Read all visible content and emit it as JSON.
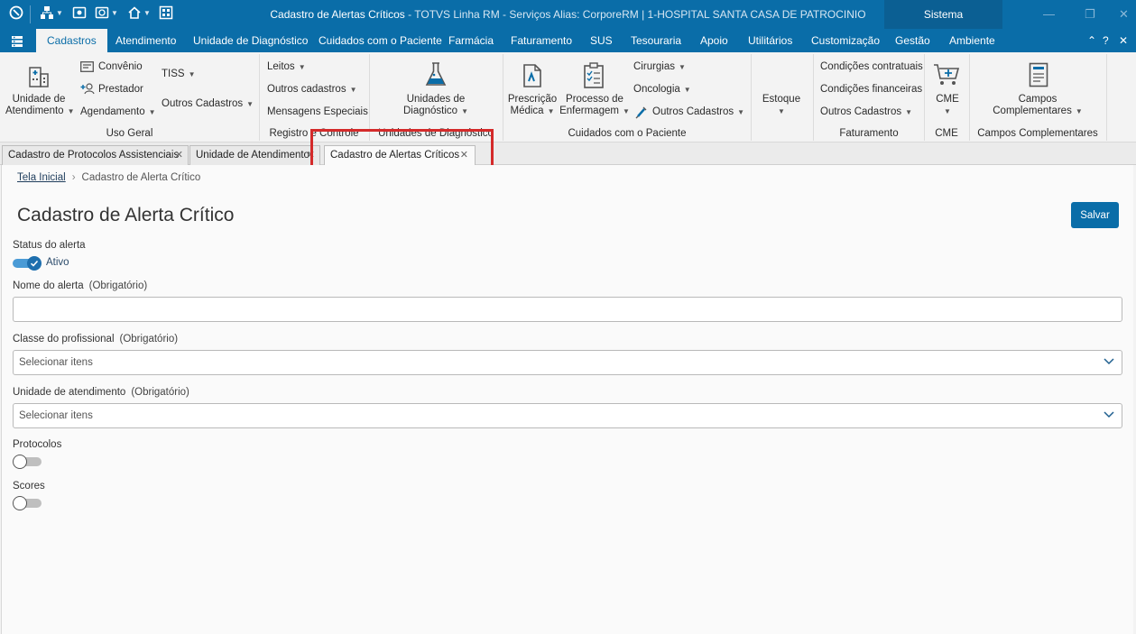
{
  "window": {
    "title": "Cadastro de Alertas Críticos",
    "subtitle": " - TOTVS Linha RM - Serviços  Alias: CorporeRM | 1-HOSPITAL SANTA CASA DE PATROCINIO",
    "sistema": "Sistema"
  },
  "menu": {
    "tabs": [
      "Cadastros",
      "Atendimento",
      "Unidade de Diagnóstico",
      "Cuidados com o Paciente",
      "Farmácia",
      "Faturamento",
      "SUS",
      "Tesouraria",
      "Apoio",
      "Utilitários",
      "Customização",
      "Gestão",
      "Ambiente"
    ],
    "active": "Cadastros"
  },
  "ribbon": {
    "uso_geral": {
      "label": "Uso Geral",
      "unidade_line1": "Unidade de",
      "unidade_line2": "Atendimento",
      "convenio": "Convênio",
      "prestador": "Prestador",
      "agendamento": "Agendamento",
      "tiss": "TISS",
      "outros": "Outros Cadastros"
    },
    "registro": {
      "label": "Registro e Controle",
      "leitos": "Leitos",
      "outros": "Outros cadastros",
      "mensagens": "Mensagens  Especiais"
    },
    "diag": {
      "label": "Unidades de Diagnóstico",
      "line1": "Unidades de",
      "line2": "Diagnóstico"
    },
    "cuidados": {
      "label": "Cuidados com o Paciente",
      "prescricao1": "Prescrição",
      "prescricao2": "Médica",
      "processo1": "Processo de",
      "processo2": "Enfermagem",
      "cirurgias": "Cirurgias",
      "oncologia": "Oncologia",
      "outros": "Outros Cadastros"
    },
    "estoque": {
      "label": "Estoque"
    },
    "faturamento": {
      "label": "Faturamento",
      "contratuais": "Condições contratuais",
      "financeiras": "Condições financeiras",
      "outros": "Outros Cadastros"
    },
    "cme": {
      "label": "CME",
      "button": "CME"
    },
    "campos": {
      "label": "Campos Complementares",
      "line1": "Campos",
      "line2": "Complementares"
    }
  },
  "doc_tabs": [
    "Cadastro de Protocolos Assistenciais",
    "Unidade de Atendimento",
    "Cadastro de Alertas Críticos"
  ],
  "breadcrumb": {
    "home": "Tela Inicial",
    "current": "Cadastro de Alerta Crítico"
  },
  "page": {
    "title": "Cadastro de Alerta Crítico",
    "save": "Salvar"
  },
  "form": {
    "status_label": "Status do alerta",
    "status_value": "Ativo",
    "nome_label": "Nome do alerta",
    "classe_label": "Classe do profissional",
    "unidade_label": "Unidade de atendimento",
    "required": "(Obrigatório)",
    "select_placeholder": "Selecionar itens",
    "protocolos_label": "Protocolos",
    "scores_label": "Scores"
  },
  "colors": {
    "accent": "#0a6da8",
    "highlight": "#d42a2a"
  }
}
